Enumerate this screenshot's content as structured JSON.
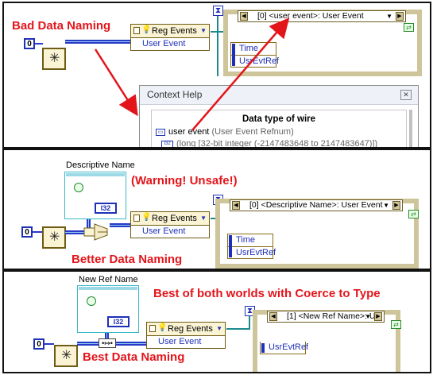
{
  "panel1": {
    "title": "Bad Data Naming",
    "const_value": "0",
    "reg_events_label": "Reg Events",
    "user_event_label": "User Event",
    "event_case_header": "[0] <user event>: User Event",
    "time_label": "Time",
    "ref_label": "UsrEvtRef",
    "help": {
      "window_title": "Context Help",
      "heading": "Data type of wire",
      "line1_name": "user event",
      "line1_type": "(User Event Refnum)",
      "line2": "(long [32-bit integer (-2147483648 to 2147483647)])",
      "icon_text": "I32"
    }
  },
  "panel2": {
    "title": "Better Data Naming",
    "warning": "(Warning! Unsafe!)",
    "constant_label": "Descriptive Name",
    "i32_label": "I32",
    "const_value": "0",
    "reg_events_label": "Reg Events",
    "user_event_label": "User Event",
    "event_case_header": "[0] <Descriptive Name>: User Event",
    "time_label": "Time",
    "ref_label": "UsrEvtRef"
  },
  "panel3": {
    "title": "Best Data Naming",
    "subtitle": "Best of both worlds with Coerce to Type",
    "constant_label": "New Ref Name",
    "i32_label": "I32",
    "const_value": "0",
    "reg_events_label": "Reg Events",
    "user_event_label": "User Event",
    "event_case_header": "[1] <New Ref Name>: U",
    "ref_label": "UsrEvtRef"
  },
  "colors": {
    "accent_red": "#e3151b",
    "wire_blue": "#2838c8",
    "frame_tan": "#cfc59a"
  }
}
